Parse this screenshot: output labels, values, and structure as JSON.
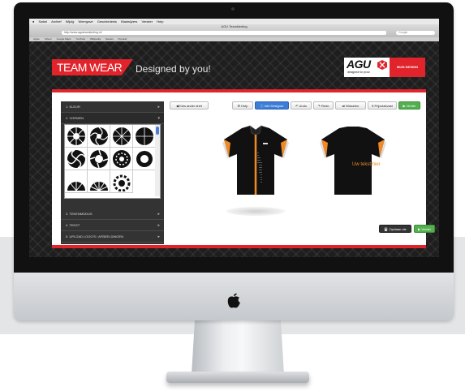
{
  "browser": {
    "menu_items": [
      "Safari",
      "Archief",
      "Wijzig",
      "Weergave",
      "Geschiedenis",
      "Bladwijzers",
      "Venster",
      "Help"
    ],
    "window_title": "AGU Teamkleding",
    "url": "http://www.aguteamkleding.nl/",
    "search_placeholder": "Google",
    "bookmarks": [
      "Apple",
      "Yahoo!",
      "Google Maps",
      "YouTube",
      "Wikipedia",
      "Nieuws",
      "Populair"
    ]
  },
  "header": {
    "team_wear": "TEAM WEAR",
    "tagline": "Designed by you!",
    "brand": "AGU",
    "brand_tagline": "designed for pros!",
    "mijn_design": "MIJN DESIGN"
  },
  "sidebar": {
    "sections": [
      {
        "label": "1. KLEUR"
      },
      {
        "label": "2. VORMEN"
      },
      {
        "label": "3. TEKENMODUS"
      },
      {
        "label": "4. TEKST"
      },
      {
        "label": "5. UPLOAD LOGO'S / AFBEELDINGEN"
      }
    ],
    "shape_icons": [
      "shape-burst-icon",
      "shape-swirl-icon",
      "shape-circle-icon",
      "shape-swirl-icon",
      "shape-swirl-icon",
      "shape-circle-icon",
      "shape-swirl-icon",
      "shape-swirl-icon",
      "shape-circle-icon",
      "shape-circle-icon",
      "shape-burst-icon",
      "shape-gear-icon"
    ]
  },
  "toolbar": {
    "kies_ander_shirt": "Kies ander shirt",
    "hulp": "Hulp",
    "info_designer": "Info Designer",
    "undo": "Undo",
    "redo": "Redo",
    "wisselen": "Wisselen",
    "prijsvlakvast": "Prijsvlakvast",
    "verder": "Verder"
  },
  "canvas": {
    "back_text": "Uw tekst hier"
  },
  "footer_buttons": {
    "opslaan": "Opslaan als",
    "verder": "Verder"
  },
  "colors": {
    "accent_red": "#e1232b",
    "orange": "#f08a24",
    "blue_button": "#3b7dd8",
    "green_button": "#54b04f"
  }
}
